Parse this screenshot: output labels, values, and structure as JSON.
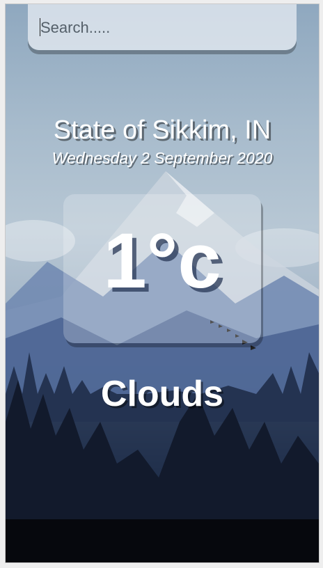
{
  "search": {
    "placeholder": "Search....."
  },
  "location": {
    "name": "State of Sikkim, IN"
  },
  "date": {
    "text": "Wednesday 2 September 2020"
  },
  "weather": {
    "temperature": "1°c",
    "condition": "Clouds"
  },
  "background": {
    "scene": "mountain-forest-landscape"
  }
}
